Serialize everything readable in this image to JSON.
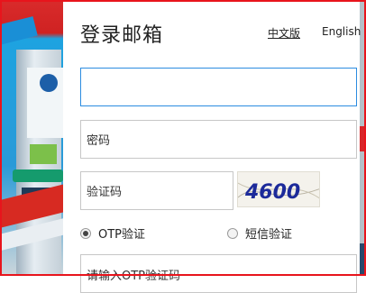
{
  "login": {
    "title": "登录邮箱",
    "lang_chinese": "中文版",
    "lang_english": "English",
    "email_value": "",
    "password_placeholder": "密码",
    "captcha_placeholder": "验证码",
    "captcha_text": "4600",
    "radio_otp": "OTP验证",
    "radio_sms": "短信验证",
    "otp_placeholder": "请输入OTP验证码",
    "selected_method": "OTP验证"
  },
  "colors": {
    "accent_blue": "#2c8ce0",
    "border_red": "#e8141c"
  }
}
